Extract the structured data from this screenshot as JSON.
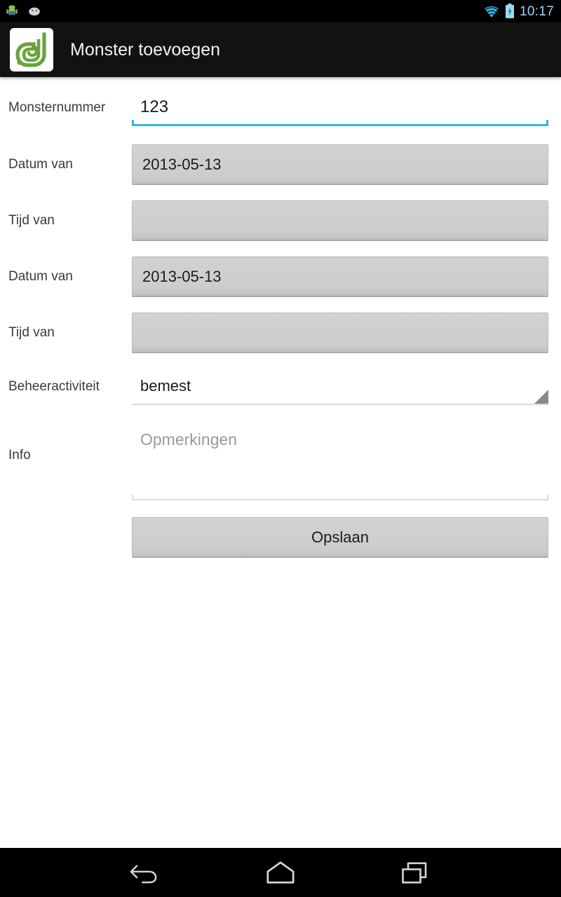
{
  "status_bar": {
    "time": "10:17",
    "notifications": [
      "android-robot-icon",
      "android-head-icon"
    ],
    "wifi_icon": "wifi-icon",
    "battery_icon": "battery-charging-icon",
    "time_color": "#9fd8ef"
  },
  "action_bar": {
    "title": "Monster toevoegen",
    "logo_icon": "app-leaf-logo-icon",
    "logo_color": "#6aa33a",
    "background": "#121212"
  },
  "form": {
    "rows": [
      {
        "label": "Monsternummer",
        "value": "123",
        "type": "edit-focused"
      },
      {
        "label": "Datum van",
        "value": "2013-05-13",
        "type": "date-button"
      },
      {
        "label": "Tijd van",
        "value": "",
        "type": "time-button"
      },
      {
        "label": "Datum van",
        "value": "2013-05-13",
        "type": "date-button"
      },
      {
        "label": "Tijd van",
        "value": "",
        "type": "time-button"
      },
      {
        "label": "Beheeractiviteit",
        "value": "bemest",
        "type": "spinner"
      },
      {
        "label": "Info",
        "value": "",
        "placeholder": "Opmerkingen",
        "type": "multiline"
      }
    ],
    "save_label": "Opslaan"
  },
  "nav_bar": {
    "back_icon": "back-icon",
    "home_icon": "home-icon",
    "recents_icon": "recents-icon"
  },
  "colors": {
    "accent_blue": "#33b5e5",
    "button_gray": "#cccccc",
    "label_gray": "#3a3a3a",
    "placeholder_gray": "#9a9a9a"
  }
}
